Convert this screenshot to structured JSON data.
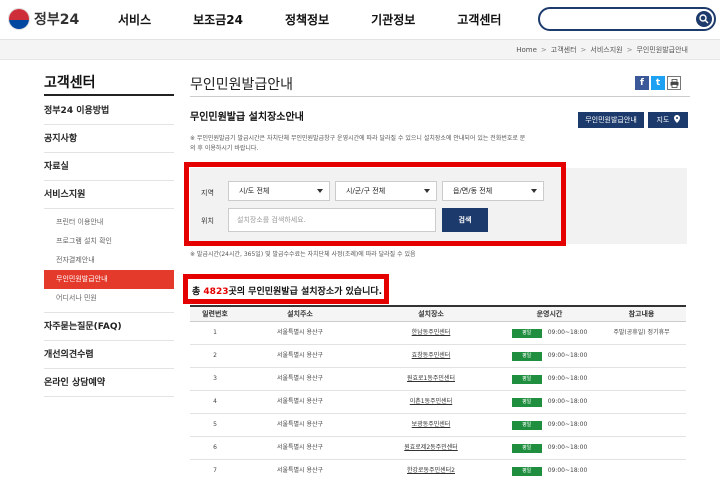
{
  "header": {
    "logo_text": "정부24",
    "nav": [
      "서비스",
      "보조금24",
      "정책정보",
      "기관정보",
      "고객센터"
    ]
  },
  "breadcrumb": [
    "Home",
    "고객센터",
    "서비스지원",
    "무인민원발급안내"
  ],
  "sidebar": {
    "title": "고객센터",
    "items": [
      {
        "label": "정부24 이용방법"
      },
      {
        "label": "공지사항"
      },
      {
        "label": "자료실"
      },
      {
        "label": "서비스지원"
      }
    ],
    "subitems": [
      "프린터 이용안내",
      "프로그램 설치 확인",
      "전자결제안내",
      "무인민원발급안내",
      "어디서나 민원"
    ],
    "active_subitem": "무인민원발급안내",
    "items_after": [
      {
        "label": "자주묻는질문(FAQ)"
      },
      {
        "label": "개선의견수렴"
      },
      {
        "label": "온라인 상담예약"
      }
    ]
  },
  "page": {
    "title": "무인민원발급안내",
    "section_title": "무인민원발급 설치장소안내",
    "guide_button": "무인민원발급안내",
    "map_button": "지도",
    "notice1": "※ 무인민원발급기 발급시간은 자치단체 무인민원발급창구 운영시간에 따라 달라질 수 있으니 설치장소에 안내되어 있는 전화번호로 문의 후 이용하시기 바랍니다.",
    "notice2": "※ 발급시간(24시간, 365일) 및 발급수수료는 자치단체 사정(조례)에 따라 달라질 수 있음"
  },
  "filter": {
    "region_label": "지역",
    "location_label": "위치",
    "sido": "시/도 전체",
    "sigungu": "시/군/구 전체",
    "eupmyeondong": "읍/면/동 전체",
    "placeholder": "설치장소를 검색하세요.",
    "search_button": "검색"
  },
  "count": {
    "prefix": "총",
    "number": "4823",
    "suffix": "곳의 무인민원발급 설치장소가 있습니다."
  },
  "table": {
    "headers": [
      "일련번호",
      "설치주소",
      "설치장소",
      "운영시간",
      "참고내용"
    ],
    "rows": [
      {
        "no": "1",
        "address": "서울특별시 용산구",
        "place": "한남동주민센터",
        "status": "평일",
        "hours": "09:00~18:00",
        "note": "주말(공휴일) 정기휴무"
      },
      {
        "no": "2",
        "address": "서울특별시 용산구",
        "place": "효창동주민센터",
        "status": "평일",
        "hours": "09:00~18:00",
        "note": ""
      },
      {
        "no": "3",
        "address": "서울특별시 용산구",
        "place": "원효로1동주민센터",
        "status": "평일",
        "hours": "09:00~18:00",
        "note": ""
      },
      {
        "no": "4",
        "address": "서울특별시 용산구",
        "place": "이촌1동주민센터",
        "status": "평일",
        "hours": "09:00~18:00",
        "note": ""
      },
      {
        "no": "5",
        "address": "서울특별시 용산구",
        "place": "보광동주민센터",
        "status": "평일",
        "hours": "09:00~18:00",
        "note": ""
      },
      {
        "no": "6",
        "address": "서울특별시 용산구",
        "place": "원효로제2동주민센터",
        "status": "평일",
        "hours": "09:00~18:00",
        "note": ""
      },
      {
        "no": "7",
        "address": "서울특별시 용산구",
        "place": "한강로동주민센터2",
        "status": "평일",
        "hours": "09:00~18:00",
        "note": ""
      }
    ]
  },
  "colors": {
    "accent": "#e43a2c",
    "navy": "#1c3a6b",
    "highlight_frame": "#e50000",
    "badge_green": "#1f8f3f"
  }
}
